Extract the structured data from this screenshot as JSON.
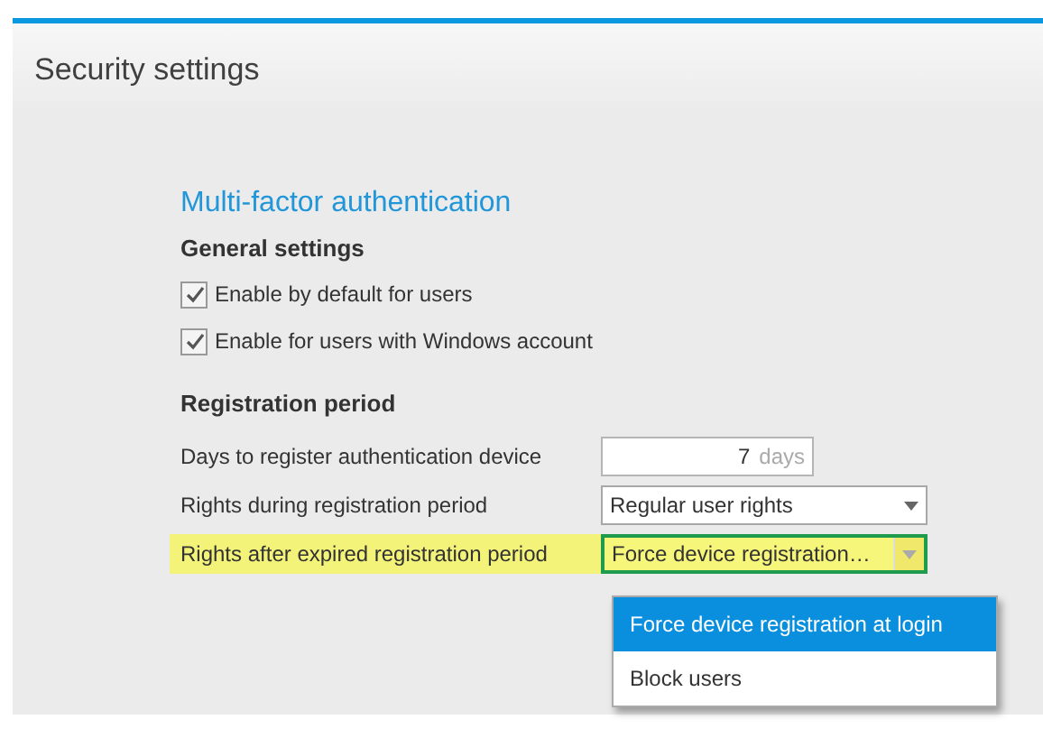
{
  "panel": {
    "title": "Security settings"
  },
  "section_heading": "Multi-factor authentication",
  "general_settings": {
    "heading": "General settings",
    "checkboxes": [
      {
        "label": "Enable by default for users",
        "checked": true
      },
      {
        "label": "Enable for users with Windows account",
        "checked": true
      }
    ]
  },
  "registration_period": {
    "heading": "Registration period",
    "fields": [
      {
        "kind": "number",
        "label": "Days to register authentication device",
        "value": "7",
        "unit": "days",
        "highlighted": false
      },
      {
        "kind": "select",
        "label": "Rights during registration period",
        "value": "Regular user rights",
        "highlighted": false,
        "expanded": false
      },
      {
        "kind": "select",
        "label": "Rights after expired registration period",
        "value": "Force device registration…",
        "highlighted": true,
        "expanded": true,
        "options": [
          {
            "label": "Force device registration at login",
            "selected": true
          },
          {
            "label": "Block users",
            "selected": false
          }
        ]
      }
    ]
  }
}
